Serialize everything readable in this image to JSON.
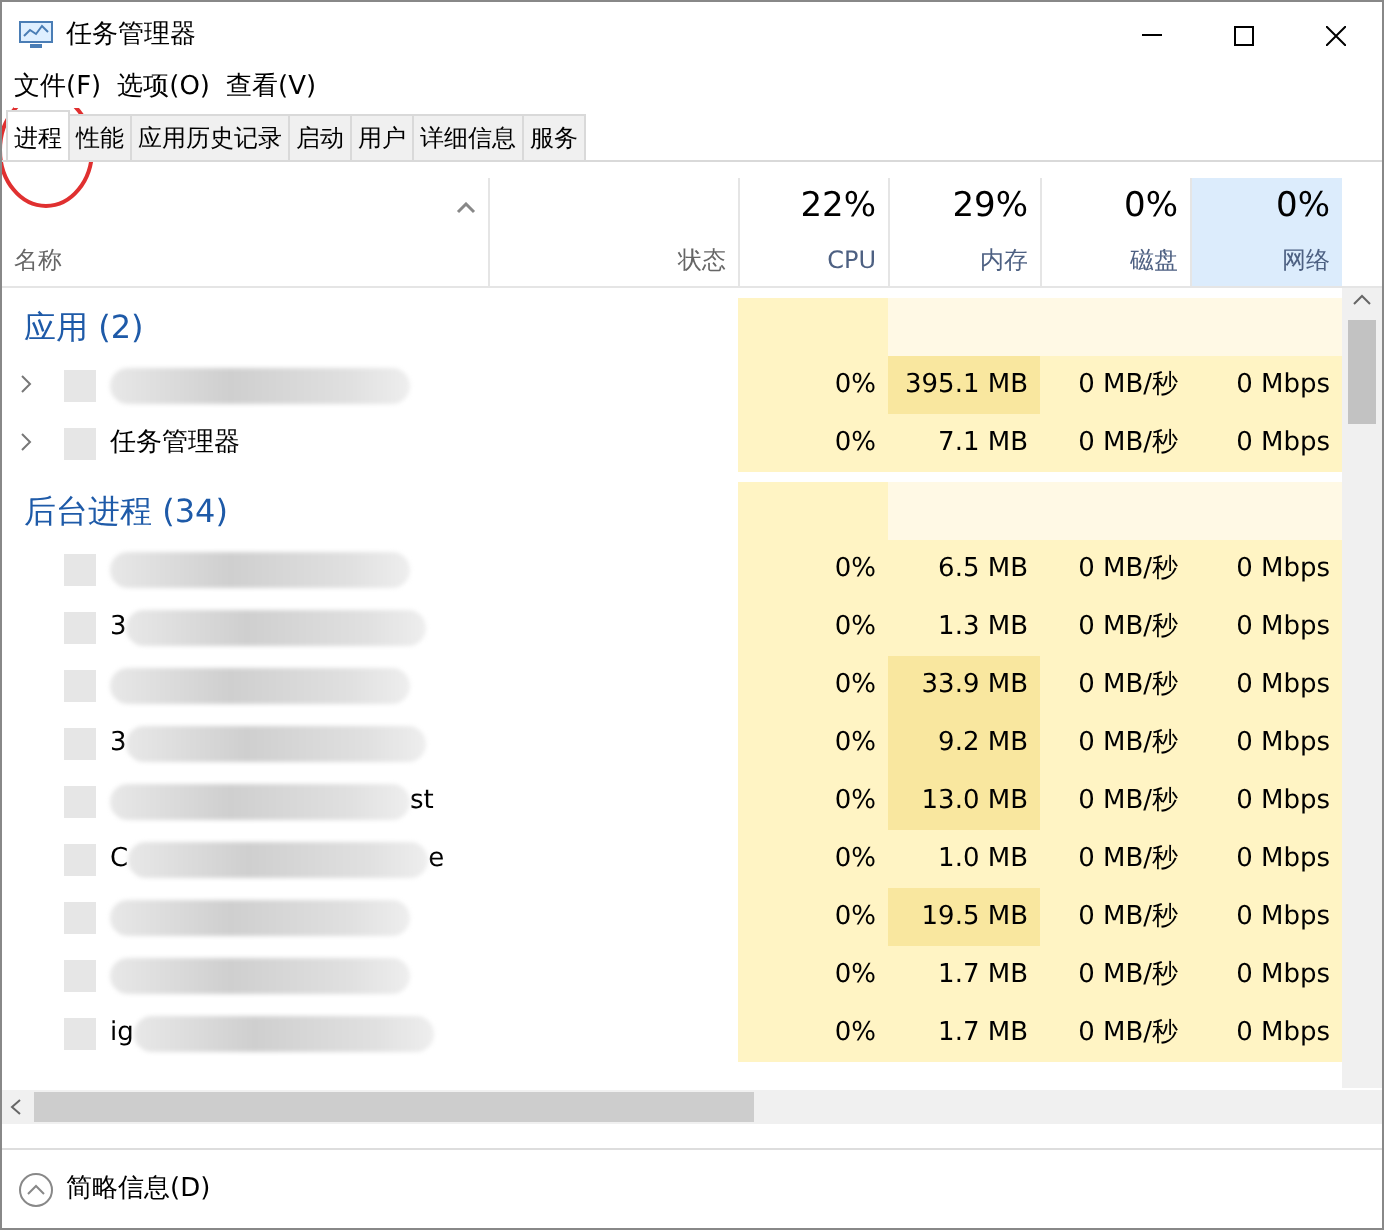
{
  "window": {
    "title": "任务管理器"
  },
  "menu": [
    "文件(F)",
    "选项(O)",
    "查看(V)"
  ],
  "tabs": [
    {
      "label": "进程",
      "selected": true
    },
    {
      "label": "性能",
      "selected": false
    },
    {
      "label": "应用历史记录",
      "selected": false
    },
    {
      "label": "启动",
      "selected": false
    },
    {
      "label": "用户",
      "selected": false
    },
    {
      "label": "详细信息",
      "selected": false
    },
    {
      "label": "服务",
      "selected": false
    }
  ],
  "columns": [
    {
      "label": "名称"
    },
    {
      "label": "状态"
    },
    {
      "label": "CPU",
      "usage": "22%"
    },
    {
      "label": "内存",
      "usage": "29%"
    },
    {
      "label": "磁盘",
      "usage": "0%"
    },
    {
      "label": "网络",
      "usage": "0%",
      "selected": true
    }
  ],
  "groups": [
    {
      "title": "应用 (2)",
      "rows": [
        {
          "expandable": true,
          "blurred": true,
          "cpu": "0%",
          "memory": "395.1 MB",
          "memory_high": true,
          "disk": "0 MB/秒",
          "network": "0 Mbps"
        },
        {
          "expandable": true,
          "blurred": false,
          "name": "任务管理器",
          "cpu": "0%",
          "memory": "7.1 MB",
          "memory_high": false,
          "disk": "0 MB/秒",
          "network": "0 Mbps"
        }
      ]
    },
    {
      "title": "后台进程 (34)",
      "rows": [
        {
          "expandable": false,
          "blurred": true,
          "cpu": "0%",
          "memory": "6.5 MB",
          "memory_high": false,
          "disk": "0 MB/秒",
          "network": "0 Mbps"
        },
        {
          "expandable": false,
          "blurred": true,
          "prefix": "3",
          "cpu": "0%",
          "memory": "1.3 MB",
          "memory_high": false,
          "disk": "0 MB/秒",
          "network": "0 Mbps"
        },
        {
          "expandable": false,
          "blurred": true,
          "cpu": "0%",
          "memory": "33.9 MB",
          "memory_high": true,
          "disk": "0 MB/秒",
          "network": "0 Mbps"
        },
        {
          "expandable": false,
          "blurred": true,
          "prefix": "3",
          "cpu": "0%",
          "memory": "9.2 MB",
          "memory_high": true,
          "disk": "0 MB/秒",
          "network": "0 Mbps"
        },
        {
          "expandable": false,
          "blurred": true,
          "suffix": "st",
          "cpu": "0%",
          "memory": "13.0 MB",
          "memory_high": true,
          "disk": "0 MB/秒",
          "network": "0 Mbps"
        },
        {
          "expandable": false,
          "blurred": true,
          "prefix": "C",
          "suffix": "e",
          "cpu": "0%",
          "memory": "1.0 MB",
          "memory_high": false,
          "disk": "0 MB/秒",
          "network": "0 Mbps"
        },
        {
          "expandable": false,
          "blurred": true,
          "cpu": "0%",
          "memory": "19.5 MB",
          "memory_high": true,
          "disk": "0 MB/秒",
          "network": "0 Mbps"
        },
        {
          "expandable": false,
          "blurred": true,
          "cpu": "0%",
          "memory": "1.7 MB",
          "memory_high": false,
          "disk": "0 MB/秒",
          "network": "0 Mbps"
        },
        {
          "expandable": false,
          "blurred": true,
          "prefix": "ig",
          "cpu": "0%",
          "memory": "1.7 MB",
          "memory_high": false,
          "disk": "0 MB/秒",
          "network": "0 Mbps"
        }
      ]
    }
  ],
  "footer": {
    "label": "简略信息(D)"
  }
}
